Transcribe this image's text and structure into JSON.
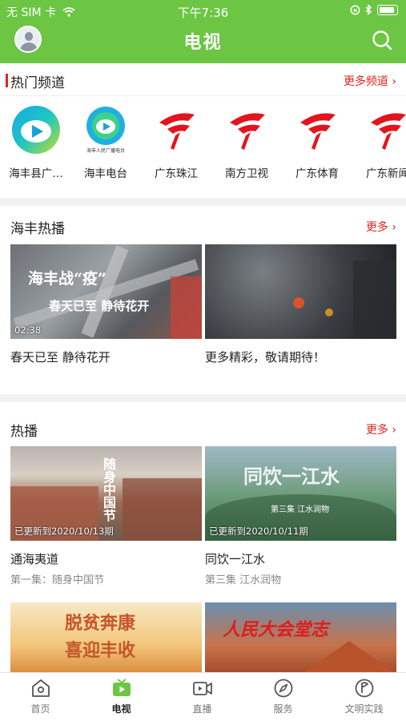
{
  "status_bar": {
    "carrier": "无 SIM 卡",
    "time": "下午7:36"
  },
  "header": {
    "title": "电视"
  },
  "hot_channels": {
    "title": "热门频道",
    "more_label": "更多频道",
    "items": [
      {
        "name": "海丰县广…",
        "logo": "haifeng-county-logo"
      },
      {
        "name": "海丰电台",
        "logo": "haifeng-radio-logo",
        "logo_caption": "海丰人民广播电台"
      },
      {
        "name": "广东珠江",
        "logo": "gdtv-logo"
      },
      {
        "name": "南方卫视",
        "logo": "gdtv-logo"
      },
      {
        "name": "广东体育",
        "logo": "gdtv-logo"
      },
      {
        "name": "广东新闻",
        "logo": "gdtv-logo"
      }
    ]
  },
  "haifeng_hot": {
    "title": "海丰热播",
    "more_label": "更多",
    "items": [
      {
        "title": "春天已至 静待花开",
        "duration": "02:38",
        "overlay_line1": "海丰战“疫”",
        "overlay_line2": "春天已至 静待花开"
      },
      {
        "title": "更多精彩，敬请期待！"
      }
    ]
  },
  "hot": {
    "title": "热播",
    "more_label": "更多",
    "items": [
      {
        "title": "通海夷道",
        "subtitle": "第一集：随身中国节",
        "update": "已更新到2020/10/13期",
        "overlay": "随身中国节"
      },
      {
        "title": "同饮一江水",
        "subtitle": "第三集 江水润物",
        "update": "已更新到2020/10/11期",
        "overlay": "同饮一江水",
        "overlay_sub": "第三集 江水润物"
      },
      {
        "overlay_line1": "脱贫奔康",
        "overlay_line2": "喜迎丰收"
      },
      {
        "overlay": "人民大会堂志"
      }
    ]
  },
  "tabs": [
    {
      "label": "首页",
      "icon": "home-icon"
    },
    {
      "label": "电视",
      "icon": "tv-icon",
      "active": true
    },
    {
      "label": "直播",
      "icon": "live-icon"
    },
    {
      "label": "服务",
      "icon": "compass-icon"
    },
    {
      "label": "文明实践",
      "icon": "flag-icon"
    }
  ],
  "colors": {
    "brand": "#6cc644",
    "accent": "#d9261c"
  }
}
